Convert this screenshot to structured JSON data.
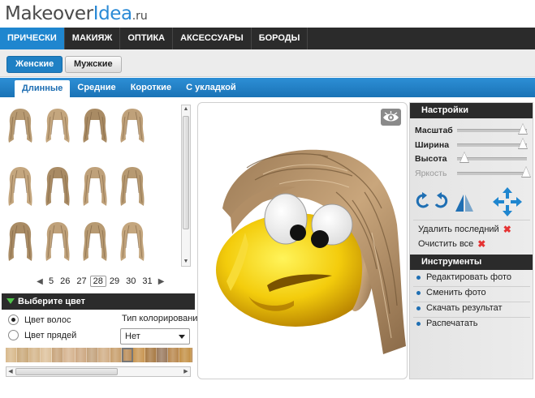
{
  "logo": {
    "part1": "Makeover",
    "part2": "Idea",
    "part3": ".ru"
  },
  "topnav": {
    "items": [
      "ПРИЧЕСКИ",
      "МАКИЯЖ",
      "ОПТИКА",
      "АКСЕССУАРЫ",
      "БОРОДЫ"
    ],
    "active_index": 0
  },
  "gender": {
    "female": "Женские",
    "male": "Мужские",
    "selected": "Женские"
  },
  "length_tabs": {
    "items": [
      "Длинные",
      "Средние",
      "Короткие",
      "С укладкой"
    ],
    "active_index": 0
  },
  "hair_grid": {
    "count": 12,
    "columns": 4
  },
  "pager": {
    "pages": [
      "5",
      "26",
      "27",
      "28",
      "29",
      "30",
      "31"
    ],
    "current": "28",
    "prev_icon": "arrow-left-icon",
    "next_icon": "arrow-right-icon"
  },
  "color": {
    "header": "Выберите цвет",
    "hair_color_label": "Цвет волос",
    "strands_label": "Цвет прядей",
    "selected_option": "Цвет волос",
    "coloring_type_label": "Тип колорирования",
    "coloring_type_value": "Нет",
    "swatches": [
      "#d8b98c",
      "#c9a879",
      "#d4b58a",
      "#ddc19b",
      "#c7a37a",
      "#d6b490",
      "#cda882",
      "#c3a27c",
      "#d0ad85",
      "#c79e6b",
      "#b98a54",
      "#c89653",
      "#a87a44",
      "#9a7a5e",
      "#b8874d",
      "#c39045",
      "#a8733a",
      "#b67a3a",
      "#a66a2d",
      "#9e5f27",
      "#96592a",
      "#8d4f21"
    ],
    "selected_swatch_index": 10
  },
  "settings": {
    "header": "Настройки",
    "sliders": [
      {
        "label": "Масштаб",
        "value": 0.95,
        "enabled": true
      },
      {
        "label": "Ширина",
        "value": 0.95,
        "enabled": true
      },
      {
        "label": "Высота",
        "value": 0.05,
        "enabled": true
      },
      {
        "label": "Яркость",
        "value": 1.0,
        "enabled": false
      }
    ],
    "delete_last": "Удалить последний",
    "clear_all": "Очистить все"
  },
  "tools": {
    "header": "Инструменты",
    "links": [
      "Редактировать фото",
      "Сменить фото",
      "Скачать результат",
      "Распечатать"
    ]
  },
  "colors": {
    "accent_blue": "#1f86cf",
    "dark_bar": "#2b2b2b",
    "delete_red": "#e53333"
  }
}
